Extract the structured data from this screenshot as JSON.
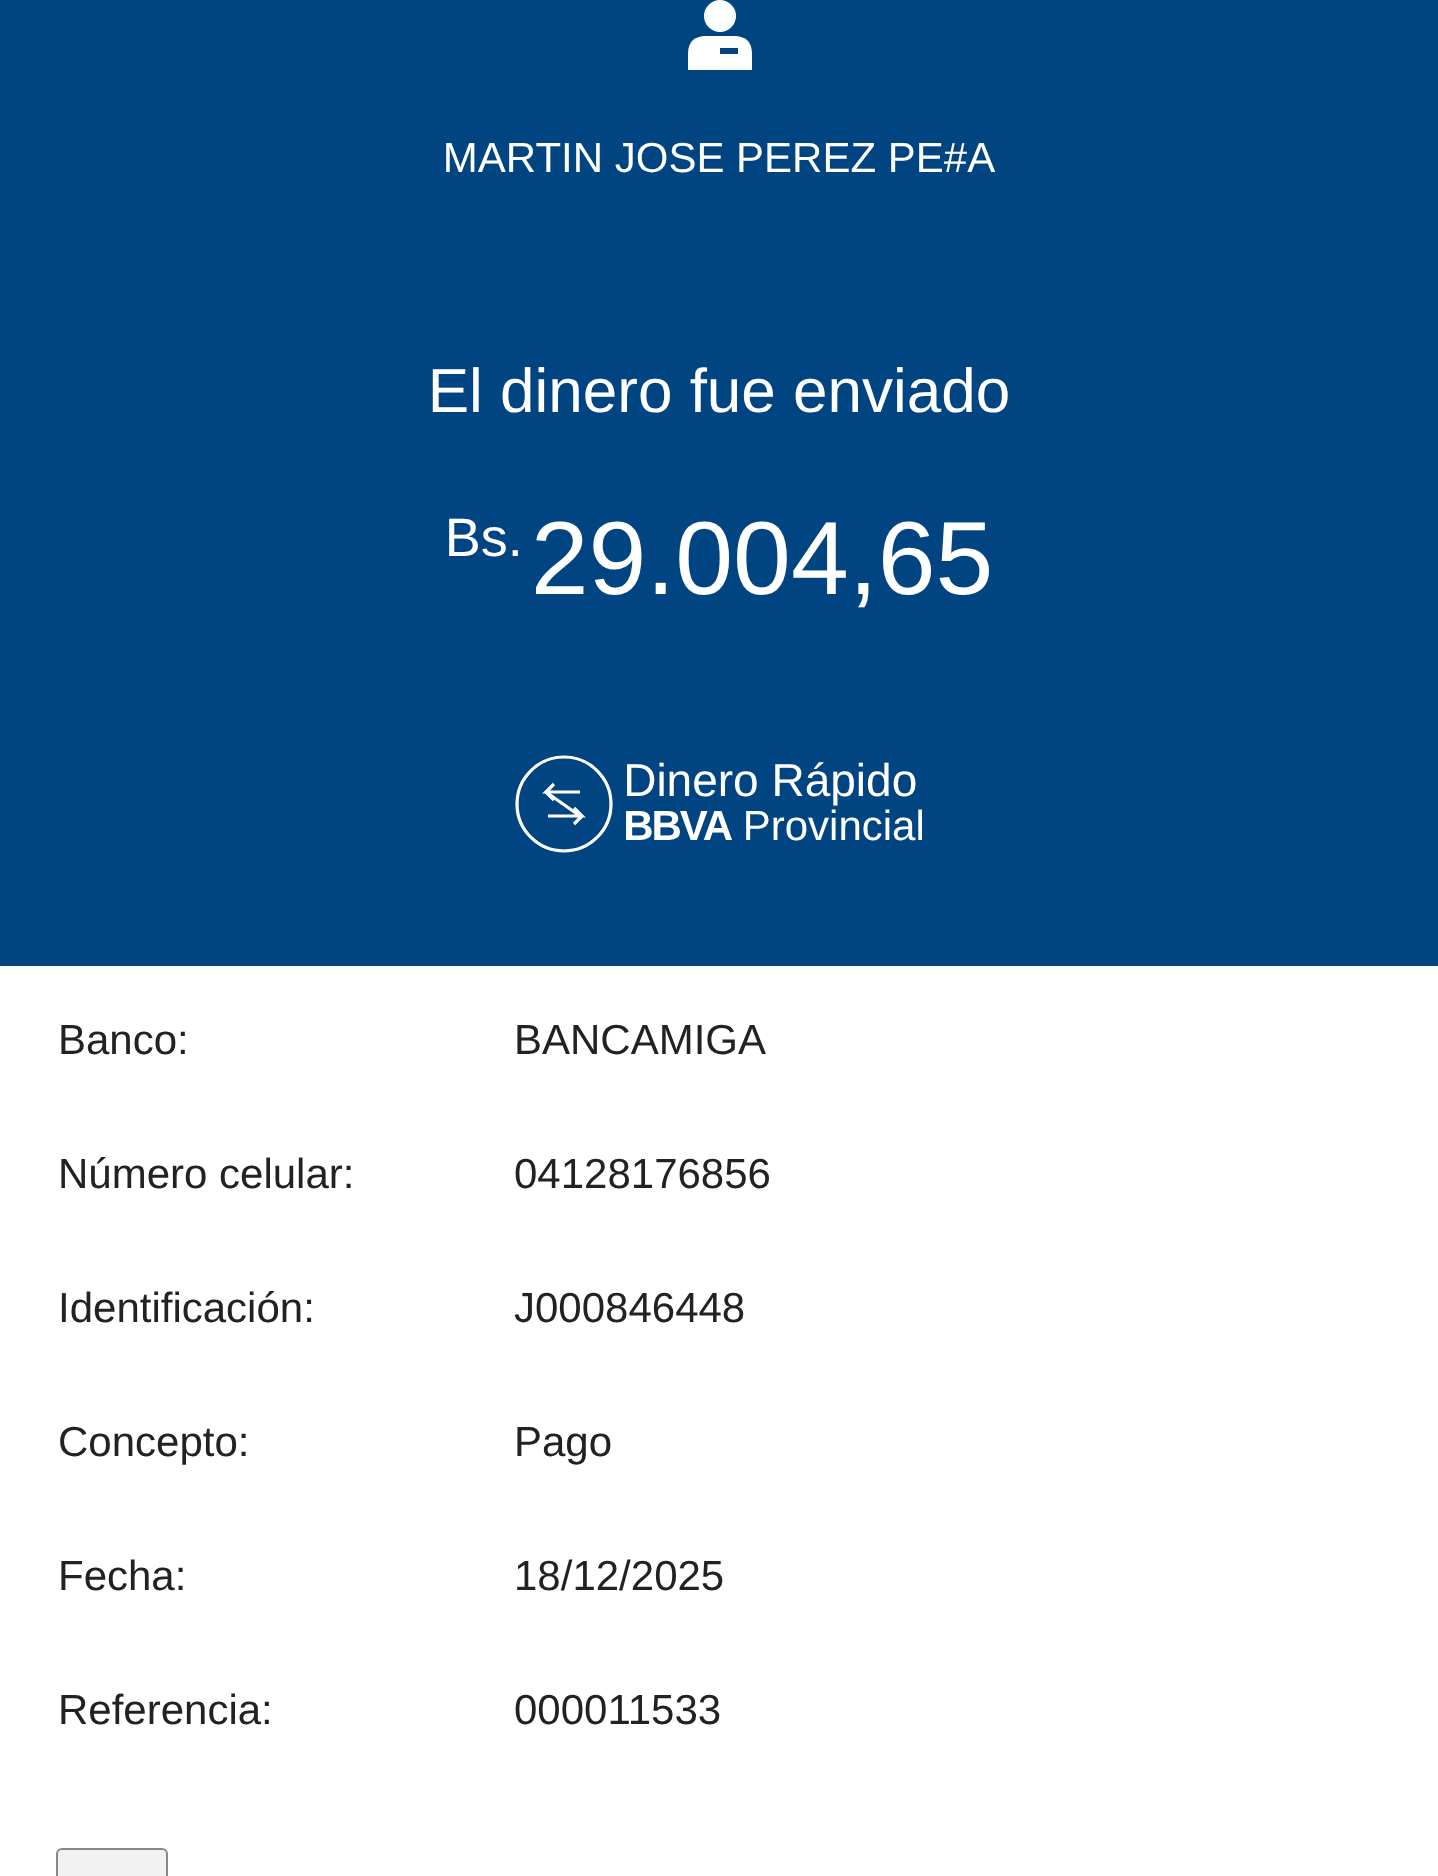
{
  "recipient": {
    "name": "MARTIN JOSE PEREZ PE#A"
  },
  "status": {
    "title": "El dinero fue enviado"
  },
  "amount": {
    "currency": "Bs.",
    "value": "29.004,65"
  },
  "brand": {
    "line_1": "Dinero Rápido",
    "line_2_bold": "BBVA",
    "line_2": "Provincial"
  },
  "details": [
    {
      "label": "Banco:",
      "value": "BANCAMIGA"
    },
    {
      "label": "Número celular:",
      "value": "04128176856"
    },
    {
      "label": "Identificación:",
      "value": "J000846448"
    },
    {
      "label": "Concepto:",
      "value": "Pago"
    },
    {
      "label": "Fecha:",
      "value": "18/12/2025"
    },
    {
      "label": "Referencia:",
      "value": "000011533"
    }
  ]
}
